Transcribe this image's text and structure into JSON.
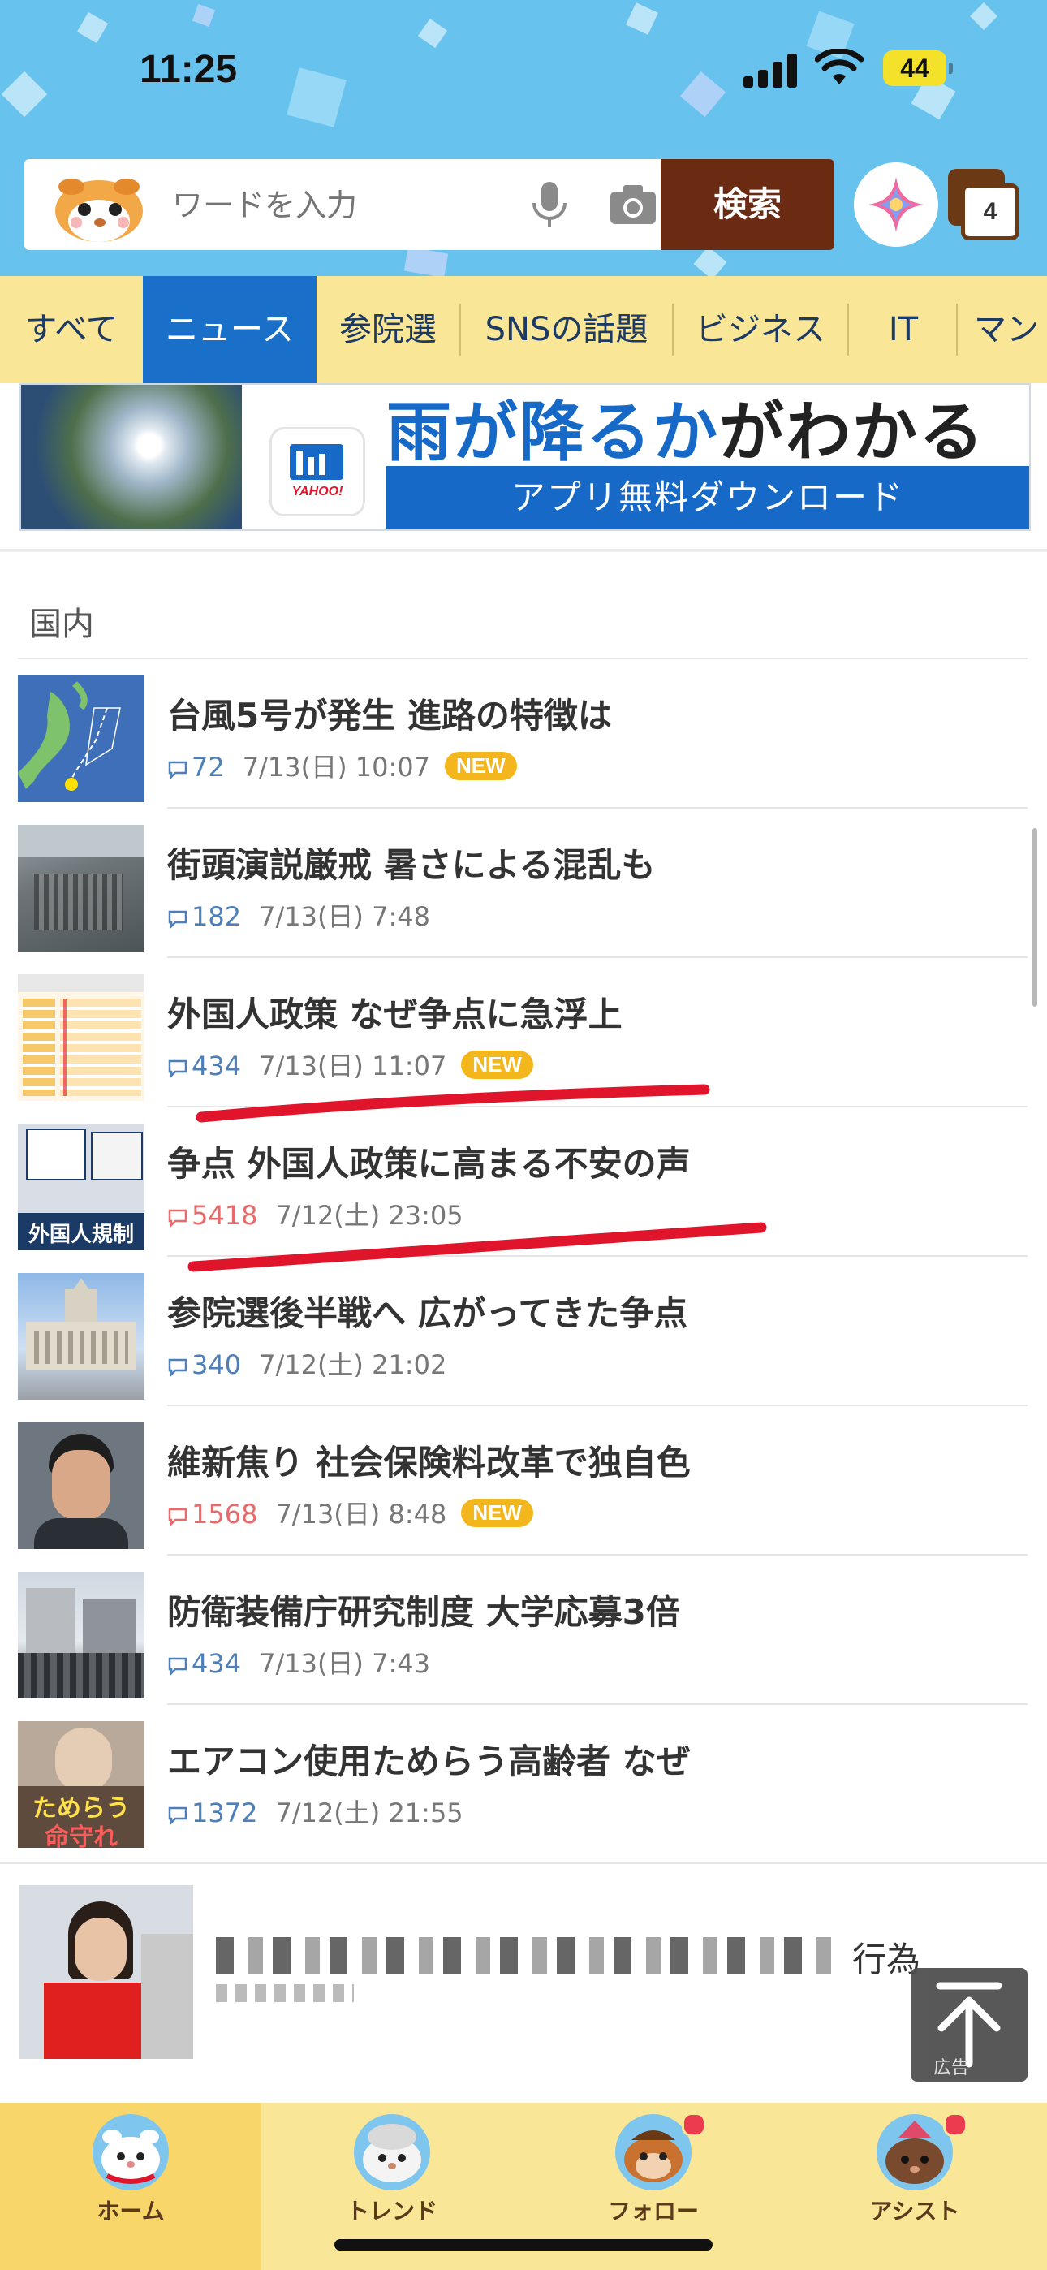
{
  "status_bar": {
    "time": "11:25",
    "battery": "44"
  },
  "search": {
    "placeholder": "ワードを入力",
    "button_label": "検索"
  },
  "tabs_count": "4",
  "categories": [
    "すべて",
    "ニュース",
    "参院選",
    "SNSの話題",
    "ビジネス",
    "IT",
    "マン"
  ],
  "active_category": "ニュース",
  "banner": {
    "headline_blue": "雨が降るか",
    "headline_dark": "がわかる",
    "subline": "アプリ無料ダウンロード",
    "logo_text": "YAHOO!"
  },
  "section_title": "国内",
  "news": [
    {
      "title": "台風5号が発生 進路の特徴は",
      "comments": "72",
      "date": "7/13(日) 10:07",
      "badge": "NEW",
      "hot": false
    },
    {
      "title": "街頭演説厳戒 暑さによる混乱も",
      "comments": "182",
      "date": "7/13(日) 7:48",
      "badge": "",
      "hot": false
    },
    {
      "title": "外国人政策 なぜ争点に急浮上",
      "comments": "434",
      "date": "7/13(日) 11:07",
      "badge": "NEW",
      "hot": false
    },
    {
      "title": "争点 外国人政策に高まる不安の声",
      "comments": "5418",
      "date": "7/12(土) 23:05",
      "badge": "",
      "hot": true
    },
    {
      "title": "参院選後半戦へ 広がってきた争点",
      "comments": "340",
      "date": "7/12(土) 21:02",
      "badge": "",
      "hot": false
    },
    {
      "title": "維新焦り 社会保険料改革で独自色",
      "comments": "1568",
      "date": "7/13(日) 8:48",
      "badge": "NEW",
      "hot": true
    },
    {
      "title": "防衛装備庁研究制度 大学応募3倍",
      "comments": "434",
      "date": "7/13(日) 7:43",
      "badge": "",
      "hot": false
    },
    {
      "title": "エアコン使用ためらう高齢者 なぜ",
      "comments": "1372",
      "date": "7/12(土) 21:55",
      "badge": "",
      "hot": false
    }
  ],
  "thumb_texts": {
    "item4": "外国人規制",
    "item8_a": "ためらう",
    "item8_b": "命守れ"
  },
  "ad": {
    "title_fragment": "行為",
    "label": "広告"
  },
  "bottom_nav": [
    {
      "label": "ホーム",
      "active": true,
      "dot": false
    },
    {
      "label": "トレンド",
      "active": false,
      "dot": false
    },
    {
      "label": "フォロー",
      "active": false,
      "dot": true
    },
    {
      "label": "アシスト",
      "active": false,
      "dot": true
    }
  ],
  "colors": {
    "header_bg": "#67c3ee",
    "tab_bar_bg": "#fae697",
    "active_tab": "#1a70c9",
    "search_button": "#6b2a12",
    "new_badge": "#f3b61c",
    "annotation_red": "#e0142a"
  }
}
